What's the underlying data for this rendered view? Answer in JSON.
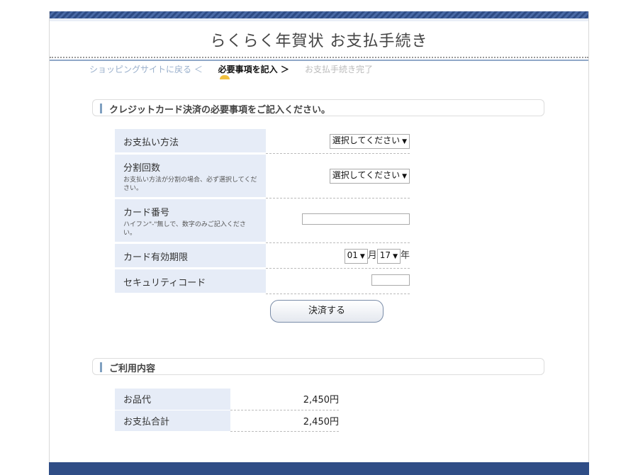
{
  "header": {
    "title": "らくらく年賀状 お支払手続き"
  },
  "breadcrumb": {
    "back": "ショッピングサイトに戻る ＜",
    "current": "必要事項を記入 ＞",
    "next": "お支払手続き完了"
  },
  "payment_section": {
    "heading": "クレジットカード決済の必要事項をご記入ください。",
    "payment_method": {
      "label": "お支払い方法",
      "value": "選択してください"
    },
    "installments": {
      "label": "分割回数",
      "note": "お支払い方法が分割の場合、必ず選択してください。",
      "value": "選択してください"
    },
    "card_number": {
      "label": "カード番号",
      "note": "ハイフン\"-\"無しで、数字のみご記入ください。",
      "value": ""
    },
    "expiry": {
      "label": "カード有効期限",
      "month": "01",
      "month_unit": "月",
      "year": "17",
      "year_unit": "年"
    },
    "security_code": {
      "label": "セキュリティコード",
      "value": ""
    },
    "submit_label": "決済する"
  },
  "usage_section": {
    "heading": "ご利用内容",
    "rows": [
      {
        "label": "お品代",
        "value": "2,450円"
      },
      {
        "label": "お支払合計",
        "value": "2,450円"
      }
    ]
  },
  "colors": {
    "brand_navy": "#2f4d86",
    "header_cell_bg": "#e6ecf7",
    "link_blue": "#9ab0cc"
  }
}
